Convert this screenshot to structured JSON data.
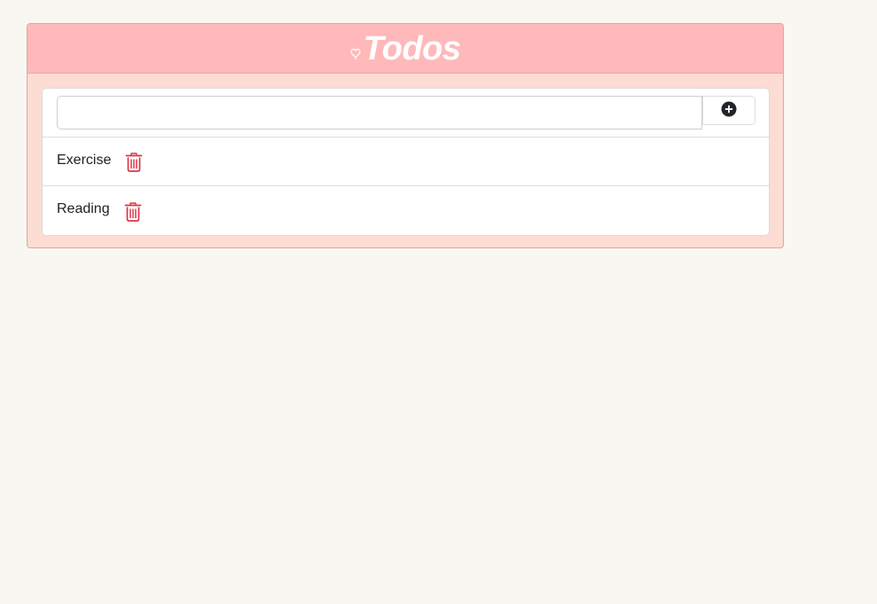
{
  "header": {
    "title": "Todos",
    "icon": "heart-icon"
  },
  "input": {
    "value": "",
    "placeholder": "",
    "add_icon": "plus-circle-icon"
  },
  "todos": [
    {
      "label": "Exercise",
      "delete_icon": "trash-icon"
    },
    {
      "label": "Reading",
      "delete_icon": "trash-icon"
    }
  ],
  "colors": {
    "background": "#f9f7f1",
    "header": "#ffb9ba",
    "card_body": "#fddcd3",
    "delete": "#dc3545",
    "add": "#212529"
  }
}
